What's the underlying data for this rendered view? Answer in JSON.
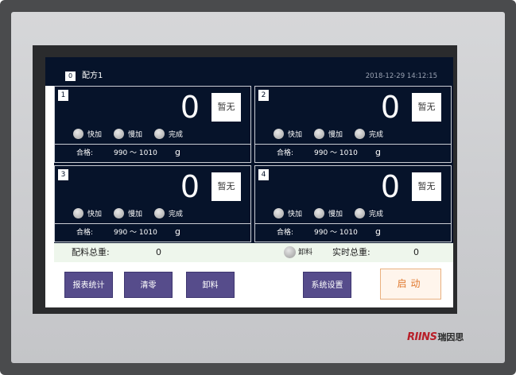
{
  "header": {
    "recipe_index": "0",
    "recipe_name": "配方1",
    "datetime": "2018-12-29 14:12:15"
  },
  "channels": [
    {
      "number": "1",
      "weight": "0",
      "status": "暂无",
      "indicators": [
        "快加",
        "慢加",
        "完成"
      ],
      "tolerance_label": "合格:",
      "tolerance_range": "990 ～ 1010",
      "unit": "g"
    },
    {
      "number": "2",
      "weight": "0",
      "status": "暂无",
      "indicators": [
        "快加",
        "慢加",
        "完成"
      ],
      "tolerance_label": "合格:",
      "tolerance_range": "990 ～ 1010",
      "unit": "g"
    },
    {
      "number": "3",
      "weight": "0",
      "status": "暂无",
      "indicators": [
        "快加",
        "慢加",
        "完成"
      ],
      "tolerance_label": "合格:",
      "tolerance_range": "990 ～ 1010",
      "unit": "g"
    },
    {
      "number": "4",
      "weight": "0",
      "status": "暂无",
      "indicators": [
        "快加",
        "慢加",
        "完成"
      ],
      "tolerance_label": "合格:",
      "tolerance_range": "990 ～ 1010",
      "unit": "g"
    }
  ],
  "totals": {
    "batch_total_label": "配料总重:",
    "batch_total_value": "0",
    "unload_label": "卸料",
    "realtime_total_label": "实时总重:",
    "realtime_total_value": "0"
  },
  "buttons": {
    "report": "报表统计",
    "zero": "清零",
    "unload": "卸料",
    "settings": "系统设置",
    "start": "启动"
  },
  "brand": {
    "logo": "RIINS",
    "name": "瑞因思"
  },
  "colors": {
    "screen_bg": "#06132a",
    "button_purple": "#564c8b",
    "start_orange": "#e0792e",
    "brand_red": "#b8202a"
  }
}
